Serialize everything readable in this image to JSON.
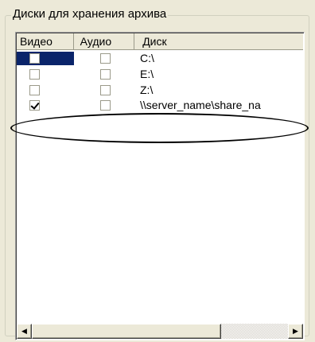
{
  "group": {
    "title": "Диски для хранения архива"
  },
  "table": {
    "headers": {
      "video": "Видео",
      "audio": "Аудио",
      "disk": "Диск"
    },
    "rows": [
      {
        "video_checked": false,
        "audio_checked": false,
        "disk": "C:\\",
        "selected": true
      },
      {
        "video_checked": false,
        "audio_checked": false,
        "disk": "E:\\",
        "selected": false
      },
      {
        "video_checked": false,
        "audio_checked": false,
        "disk": "Z:\\",
        "selected": false
      },
      {
        "video_checked": true,
        "audio_checked": false,
        "disk": "\\\\server_name\\share_na",
        "selected": false
      }
    ]
  },
  "scrollbar": {
    "left_icon": "arrow-left-icon",
    "right_icon": "arrow-right-icon"
  },
  "colors": {
    "selection": "#0a246a",
    "face": "#ece9d8"
  }
}
